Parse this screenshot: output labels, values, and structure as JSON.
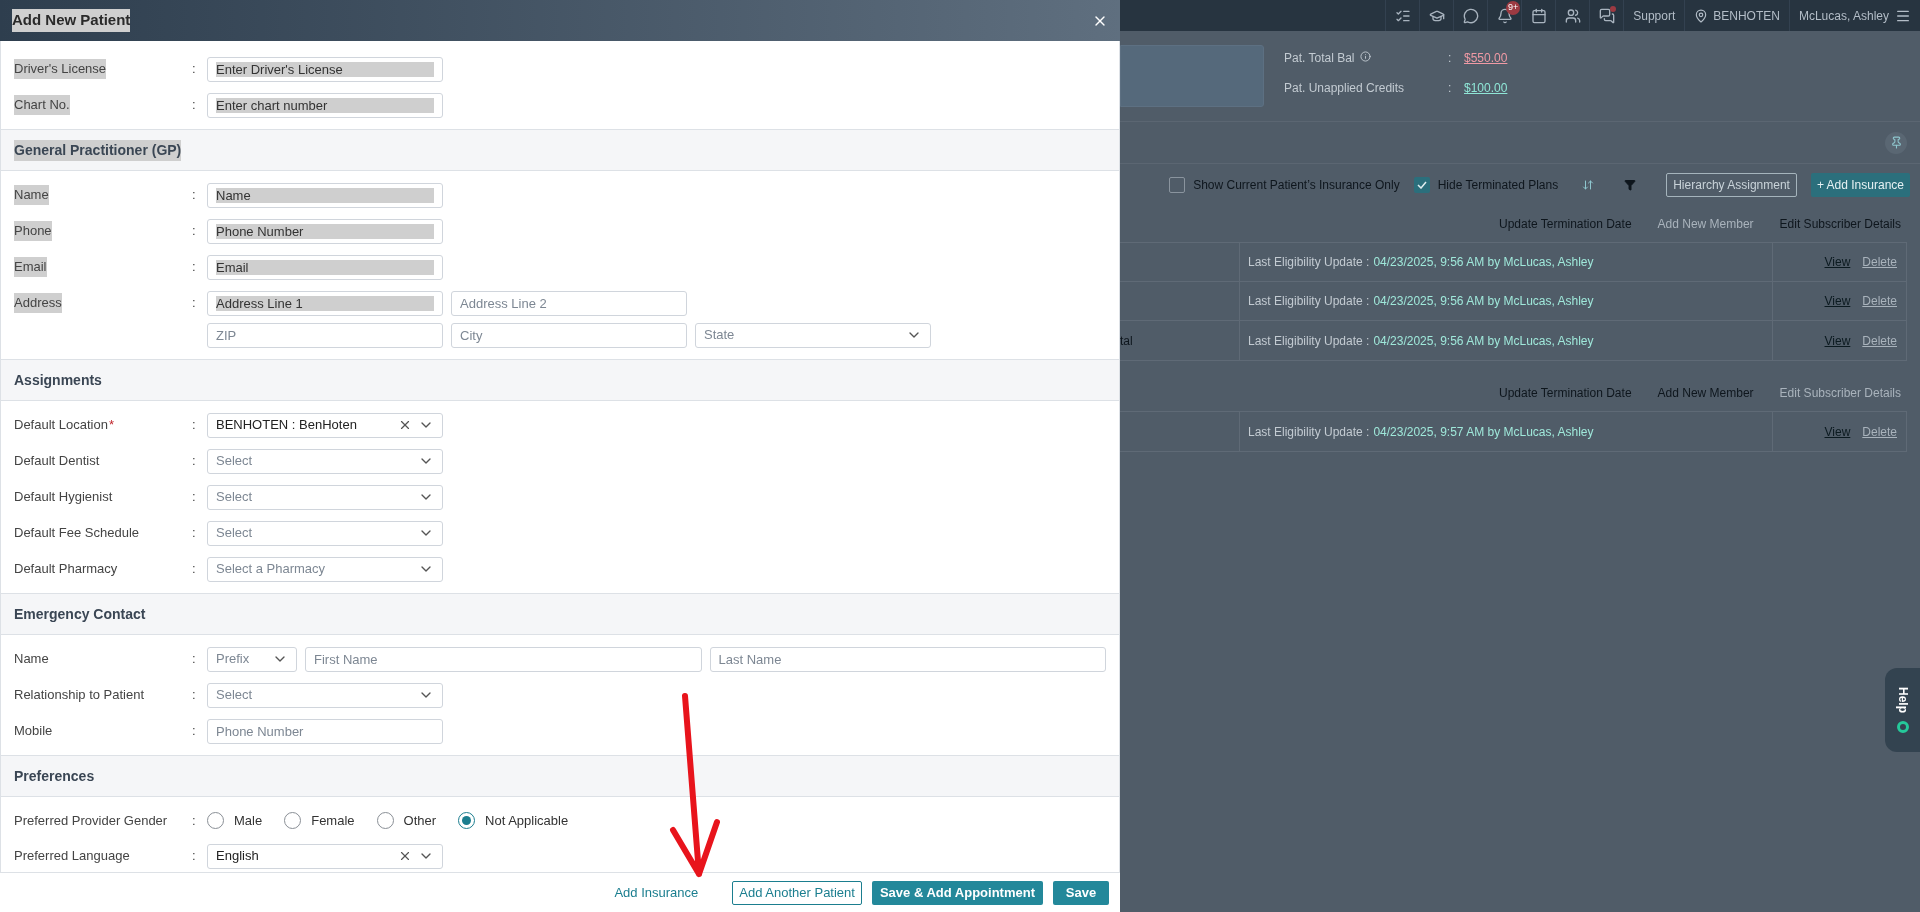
{
  "modal": {
    "title": "Add New Patient",
    "title_highlighted": true,
    "sections": [
      {
        "rows": [
          {
            "kind": "fields",
            "label": "Driver's License",
            "separator": ":",
            "highlighted": true,
            "lines": [
              [
                {
                  "kind": "text",
                  "placeholder": "Enter Driver's License",
                  "highlighted": true
                }
              ]
            ]
          },
          {
            "kind": "fields",
            "label": "Chart No.",
            "separator": ":",
            "highlighted": true,
            "lines": [
              [
                {
                  "kind": "text",
                  "placeholder": "Enter chart number",
                  "highlighted": true
                }
              ]
            ]
          }
        ]
      },
      {
        "title": "General Practitioner (GP)",
        "title_highlighted": true,
        "rows": [
          {
            "kind": "fields",
            "label": "Name",
            "separator": ":",
            "highlighted": true,
            "lines": [
              [
                {
                  "kind": "text",
                  "placeholder": "Name",
                  "highlighted": true
                }
              ]
            ]
          },
          {
            "kind": "fields",
            "label": "Phone",
            "separator": ":",
            "highlighted": true,
            "lines": [
              [
                {
                  "kind": "text",
                  "placeholder": "Phone Number",
                  "highlighted": true
                }
              ]
            ]
          },
          {
            "kind": "fields",
            "label": "Email",
            "separator": ":",
            "highlighted": true,
            "lines": [
              [
                {
                  "kind": "text",
                  "placeholder": "Email",
                  "highlighted": true
                }
              ]
            ]
          },
          {
            "kind": "fields",
            "label": "Address",
            "separator": ":",
            "highlighted": true,
            "lines": [
              [
                {
                  "kind": "text",
                  "placeholder": "Address Line 1",
                  "highlighted": true
                },
                {
                  "kind": "text",
                  "placeholder": "Address Line 2",
                  "highlighted": false
                }
              ],
              [
                {
                  "kind": "text",
                  "placeholder": "ZIP",
                  "highlighted": false
                },
                {
                  "kind": "text",
                  "placeholder": "City",
                  "highlighted": false
                },
                {
                  "kind": "select",
                  "placeholder": "State",
                  "clearable": false
                }
              ]
            ]
          }
        ]
      },
      {
        "title": "Assignments",
        "title_highlighted": false,
        "rows": [
          {
            "kind": "fields",
            "label": "Default Location",
            "required_mark": "*",
            "separator": ":",
            "highlighted": false,
            "lines": [
              [
                {
                  "kind": "select",
                  "value": "BENHOTEN : BenHoten",
                  "clearable": true
                }
              ]
            ]
          },
          {
            "kind": "fields",
            "label": "Default Dentist",
            "separator": ":",
            "highlighted": false,
            "lines": [
              [
                {
                  "kind": "select",
                  "placeholder": "Select",
                  "clearable": false
                }
              ]
            ]
          },
          {
            "kind": "fields",
            "label": "Default Hygienist",
            "separator": ":",
            "highlighted": false,
            "lines": [
              [
                {
                  "kind": "select",
                  "placeholder": "Select",
                  "clearable": false
                }
              ]
            ]
          },
          {
            "kind": "fields",
            "label": "Default Fee Schedule",
            "separator": ":",
            "highlighted": false,
            "lines": [
              [
                {
                  "kind": "select",
                  "placeholder": "Select",
                  "clearable": false
                }
              ]
            ]
          },
          {
            "kind": "fields",
            "label": "Default Pharmacy",
            "separator": ":",
            "highlighted": false,
            "lines": [
              [
                {
                  "kind": "select",
                  "placeholder": "Select a Pharmacy",
                  "clearable": false
                }
              ]
            ]
          }
        ]
      },
      {
        "title": "Emergency Contact",
        "title_highlighted": false,
        "rows": [
          {
            "kind": "name",
            "label": "Name",
            "separator": ":",
            "highlighted": false,
            "lines": [
              [
                {
                  "kind": "select",
                  "placeholder": "Prefix",
                  "clearable": false
                },
                {
                  "kind": "text",
                  "placeholder": "First Name",
                  "highlighted": false
                },
                {
                  "kind": "text",
                  "placeholder": "Last Name",
                  "highlighted": false
                }
              ]
            ]
          },
          {
            "kind": "fields",
            "label": "Relationship to Patient",
            "separator": ":",
            "highlighted": false,
            "lines": [
              [
                {
                  "kind": "select",
                  "placeholder": "Select",
                  "clearable": false
                }
              ]
            ]
          },
          {
            "kind": "fields",
            "label": "Mobile",
            "separator": ":",
            "highlighted": false,
            "lines": [
              [
                {
                  "kind": "text",
                  "placeholder": "Phone Number",
                  "highlighted": false
                }
              ]
            ]
          }
        ]
      },
      {
        "title": "Preferences",
        "title_highlighted": false,
        "rows": [
          {
            "kind": "radio",
            "label": "Preferred Provider Gender",
            "separator": ":",
            "highlighted": false,
            "options": [
              {
                "label": "Male",
                "selected": false
              },
              {
                "label": "Female",
                "selected": false
              },
              {
                "label": "Other",
                "selected": false
              },
              {
                "label": "Not Applicable",
                "selected": true
              }
            ]
          },
          {
            "kind": "fields",
            "label": "Preferred Language",
            "separator": ":",
            "highlighted": false,
            "lines": [
              [
                {
                  "kind": "select",
                  "value": "English",
                  "clearable": true
                }
              ]
            ]
          }
        ]
      }
    ],
    "buttons": [
      {
        "kind": "link",
        "label": "Add Insurance"
      },
      {
        "kind": "outline",
        "label": "Add Another Patient"
      },
      {
        "kind": "primary",
        "label": "Save & Add Appointment"
      },
      {
        "kind": "primary",
        "label": "Save"
      }
    ]
  },
  "topbar": {
    "notification_badge": "9+",
    "support": "Support",
    "location": "BENHOTEN",
    "user": "McLucas, Ashley"
  },
  "balances": [
    {
      "label": "Pat. Total Bal",
      "info": true,
      "separator": ":",
      "value": "$550.00",
      "color": "#f09aa5"
    },
    {
      "label": "Pat. Unapplied Credits",
      "info": false,
      "separator": ":",
      "value": "$100.00",
      "color": "#8fe6d6"
    }
  ],
  "toolbar": {
    "checkboxes": [
      {
        "label": "Show Current Patient’s Insurance Only",
        "checked": false
      },
      {
        "label": "Hide Terminated Plans",
        "checked": true
      }
    ],
    "buttons": [
      {
        "kind": "outline",
        "label": "Hierarchy Assignment"
      },
      {
        "kind": "primary",
        "label": "+ Add Insurance"
      }
    ]
  },
  "insurance_groups": [
    {
      "actions": [
        {
          "label": "Update Termination Date",
          "disabled": false
        },
        {
          "label": "Add New Member",
          "disabled": true
        },
        {
          "label": "Edit Subscriber Details",
          "disabled": false
        }
      ],
      "rows": [
        {
          "label": "Last Eligibility Update :",
          "value": "04/23/2025, 9:56 AM by McLucas, Ashley",
          "links": [
            {
              "label": "View",
              "disabled": false
            },
            {
              "label": "Delete",
              "disabled": true
            }
          ]
        },
        {
          "label": "Last Eligibility Update :",
          "value": "04/23/2025, 9:56 AM by McLucas, Ashley",
          "links": [
            {
              "label": "View",
              "disabled": false
            },
            {
              "label": "Delete",
              "disabled": true
            }
          ]
        },
        {
          "column_1": "tal",
          "label": "Last Eligibility Update :",
          "value": "04/23/2025, 9:56 AM by McLucas, Ashley",
          "links": [
            {
              "label": "View",
              "disabled": false
            },
            {
              "label": "Delete",
              "disabled": true
            }
          ]
        }
      ]
    },
    {
      "actions": [
        {
          "label": "Update Termination Date",
          "disabled": false
        },
        {
          "label": "Add New Member",
          "disabled": false
        },
        {
          "label": "Edit Subscriber Details",
          "disabled": true
        }
      ],
      "rows": [
        {
          "label": "Last Eligibility Update :",
          "value": "04/23/2025, 9:57 AM by McLucas, Ashley",
          "links": [
            {
              "label": "View",
              "disabled": false
            },
            {
              "label": "Delete",
              "disabled": true
            }
          ]
        }
      ]
    }
  ],
  "help_tab": {
    "label": "Help"
  }
}
